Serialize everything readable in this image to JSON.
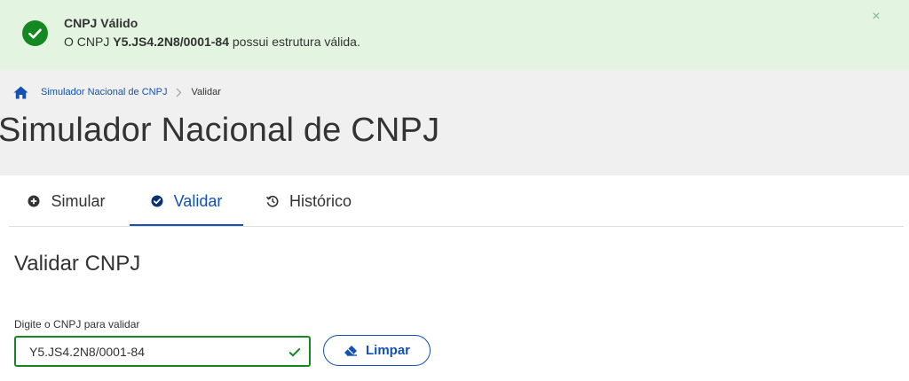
{
  "alert": {
    "title": "CNPJ Válido",
    "message_prefix": "O CNPJ",
    "cnpj": "Y5.JS4.2N8/0001-84",
    "message_suffix": "possui estrutura válida.",
    "close_label": "×",
    "icon": "check-circle-icon",
    "color": "#168821",
    "background": "#e3f5e1"
  },
  "breadcrumb": {
    "home_icon": "home-icon",
    "items": [
      "Simulador Nacional de CNPJ",
      "Validar"
    ]
  },
  "page": {
    "title": "Simulador Nacional de CNPJ"
  },
  "tabs": [
    {
      "label": "Simular",
      "icon": "plus-circle-icon",
      "active": false
    },
    {
      "label": "Validar",
      "icon": "check-circle-icon",
      "active": true
    },
    {
      "label": "Histórico",
      "icon": "history-icon",
      "active": false
    }
  ],
  "validate": {
    "section_title": "Validar CNPJ",
    "field_label": "Digite o CNPJ para validar",
    "input_value": "Y5.JS4.2N8/0001-84",
    "clear_button_label": "Limpar",
    "clear_button_icon": "eraser-icon"
  },
  "colors": {
    "primary": "#1351b4",
    "success": "#168821",
    "text": "#333333"
  }
}
